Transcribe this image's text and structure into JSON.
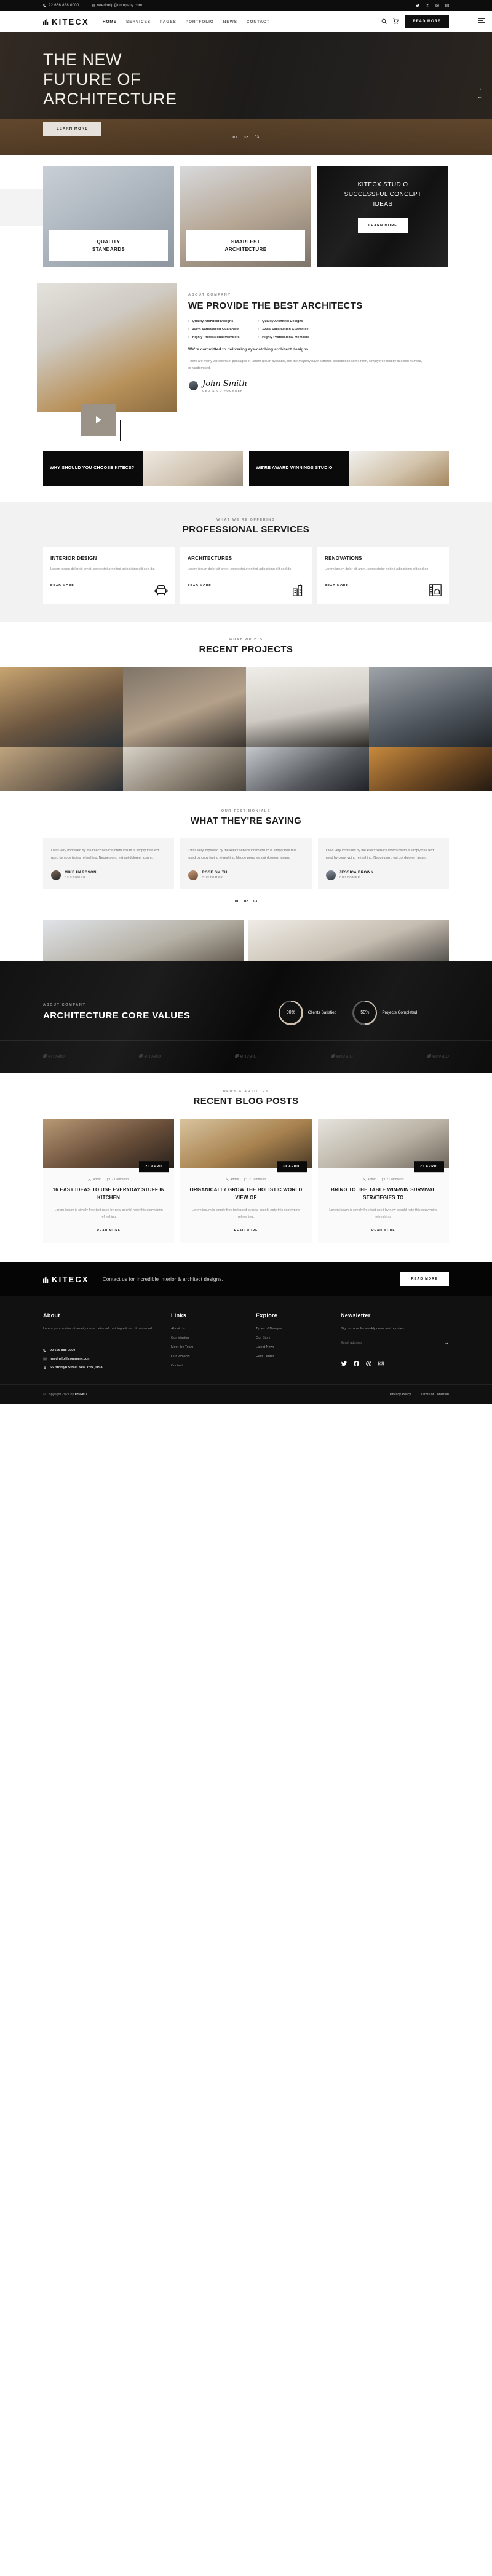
{
  "topbar": {
    "phone": "92 666 888 0000",
    "email": "needhelp@company.com",
    "socials": [
      "twitter-icon",
      "facebook-icon",
      "dribbble-icon",
      "instagram-icon"
    ]
  },
  "nav": {
    "brand": "KITECX",
    "links": [
      "HOME",
      "SERVICES",
      "PAGES",
      "PORTFOLIO",
      "NEWS",
      "CONTACT"
    ],
    "search_icon": "search-icon",
    "cart_icon": "cart-icon",
    "cta": "READ MORE"
  },
  "hero": {
    "line1": "THE NEW",
    "line2": "FUTURE OF",
    "line3": "ARCHITECTURE",
    "button": "LEARN MORE",
    "slides": [
      "01",
      "02",
      "03"
    ],
    "active_slide": "03"
  },
  "cards": [
    {
      "label": "QUALITY\nSTANDARDS",
      "type": "image"
    },
    {
      "label": "SMARTEST\nARCHITECTURE",
      "type": "image"
    },
    {
      "title": "KITECX STUDIO SUCCESSFUL CONCEPT IDEAS",
      "button": "LEARN MORE",
      "type": "dark"
    }
  ],
  "about": {
    "eyebrow": "ABOUT COMPANY",
    "title": "WE PROVIDE THE BEST ARCHITECTS",
    "features_left": [
      "Quality Architect Designs",
      "100% Satisfaction Guarantee",
      "Highly Professional Members"
    ],
    "features_right": [
      "Quality Architect Designs",
      "100% Satisfaction Guarantee",
      "Highly Professional Members"
    ],
    "lead": "We're committed to delivering eye-catching architect designs",
    "paragraph": "There are many variations of passages of Lorem Ipsum available, but the majority have suffered alteration in some form, simply free text by injected humour, or randomised.",
    "signature": "John Smith",
    "role": "CEO & CO FOUNDER",
    "play_icon": "play-icon"
  },
  "promos": [
    {
      "title": "WHY SHOULD YOU CHOOSE KITECS?"
    },
    {
      "title": "WE'RE AWARD WINNINGS STUDIO"
    }
  ],
  "services": {
    "eyebrow": "WHAT WE'RE OFFERING",
    "title": "PROFESSIONAL SERVICES",
    "items": [
      {
        "name": "INTERIOR DESIGN",
        "desc": "Lorem ipsum dolor sit amet, consectetur notted adipisicing elit sed do.",
        "link": "READ MORE",
        "icon": "armchair-icon"
      },
      {
        "name": "ARCHITECTURES",
        "desc": "Lorem ipsum dolor sit amet, consectetur notted adipisicing elit sed do.",
        "link": "READ MORE",
        "icon": "skyscraper-icon"
      },
      {
        "name": "RENOVATIONS",
        "desc": "Lorem ipsum dolor sit amet, consectetur notted adipisicing elit sed do.",
        "link": "READ MORE",
        "icon": "blueprint-ruler-icon"
      }
    ]
  },
  "projects": {
    "eyebrow": "WHAT WE DID",
    "title": "RECENT PROJECTS"
  },
  "testimonials": {
    "eyebrow": "OUR TESTIMONIALS",
    "title": "WHAT THEY'RE SAYING",
    "quote": "I was very impresed by the kitecx service lorem ipsum is simply free text used by copy typing refreshing. Neque porro est qui dolorem ipsum.",
    "items": [
      {
        "name": "MIKE HARDSON",
        "role": "CUSTOMER"
      },
      {
        "name": "ROSE SMITH",
        "role": "CUSTOMER"
      },
      {
        "name": "JESSICA BROWN",
        "role": "CUSTOMER"
      }
    ],
    "pager": [
      "01",
      "02",
      "03"
    ]
  },
  "core": {
    "eyebrow": "ABOUT COMPANY",
    "title": "ARCHITECTURE CORE VALUES",
    "stats": [
      {
        "value": "90%",
        "label": "Clients Satisfied",
        "percent": 90
      },
      {
        "value": "50%",
        "label": "Projects Completed",
        "percent": 50
      }
    ],
    "brands": [
      "envato",
      "envato",
      "envato",
      "envato",
      "envato"
    ]
  },
  "blog": {
    "eyebrow": "NEWS & ARTICLES",
    "title": "RECENT BLOG POSTS",
    "posts": [
      {
        "date": "20 APRIL",
        "author": "Admin",
        "comments": "2 Comments",
        "title": "16 EASY IDEAS TO USE EVERYDAY STUFF IN KITCHEN",
        "excerpt": "Lorem ipsum is simply free text used by new pesnhl note this copytyping refreshing.",
        "link": "READ MORE"
      },
      {
        "date": "30 APRIL",
        "author": "Admin",
        "comments": "2 Comments",
        "title": "ORGANICALLY GROW THE HOLISTIC WORLD VIEW OF",
        "excerpt": "Lorem ipsum is simply free text used by new pesnhl note this copytyping refreshing.",
        "link": "READ MORE"
      },
      {
        "date": "20 APRIL",
        "author": "Admin",
        "comments": "2 Comments",
        "title": "BRING TO THE TABLE WIN-WIN SURVIVAL STRATEGIES TO",
        "excerpt": "Lorem ipsum is simply free text used by new pesnhl note this copytyping refreshing.",
        "link": "READ MORE"
      }
    ]
  },
  "cta": {
    "brand": "KITECX",
    "text": "Contact us for incredible interior & architect designs.",
    "button": "READ MORE"
  },
  "footer": {
    "about": {
      "heading": "About",
      "desc": "Lorem ipsum dolor sit amet, consect etur adi pisicing elit sed do eiusmod.",
      "phone": "92 666 888 0000",
      "email": "needhelp@company.com",
      "address": "66 Broklyn Street New York, USA"
    },
    "links": {
      "heading": "Links",
      "items": [
        "About Us",
        "Our Mission",
        "Meet the Team",
        "Our Projects",
        "Contact"
      ]
    },
    "explore": {
      "heading": "Explore",
      "items": [
        "Types of Designs",
        "Our Story",
        "Latest News",
        "Help Center"
      ]
    },
    "newsletter": {
      "heading": "Newsletter",
      "sign": "Sign up now for weekly news and updates",
      "placeholder": "Email address",
      "value": "",
      "submit_icon": "arrow-right-icon",
      "socials": [
        "twitter-icon",
        "facebook-icon",
        "dribbble-icon",
        "instagram-icon"
      ]
    },
    "copyright_prefix": "© Copyright 2021 by",
    "copyright_brand": "DSGND",
    "legal": [
      "Privacy Policy",
      "Terms of Condition"
    ]
  }
}
